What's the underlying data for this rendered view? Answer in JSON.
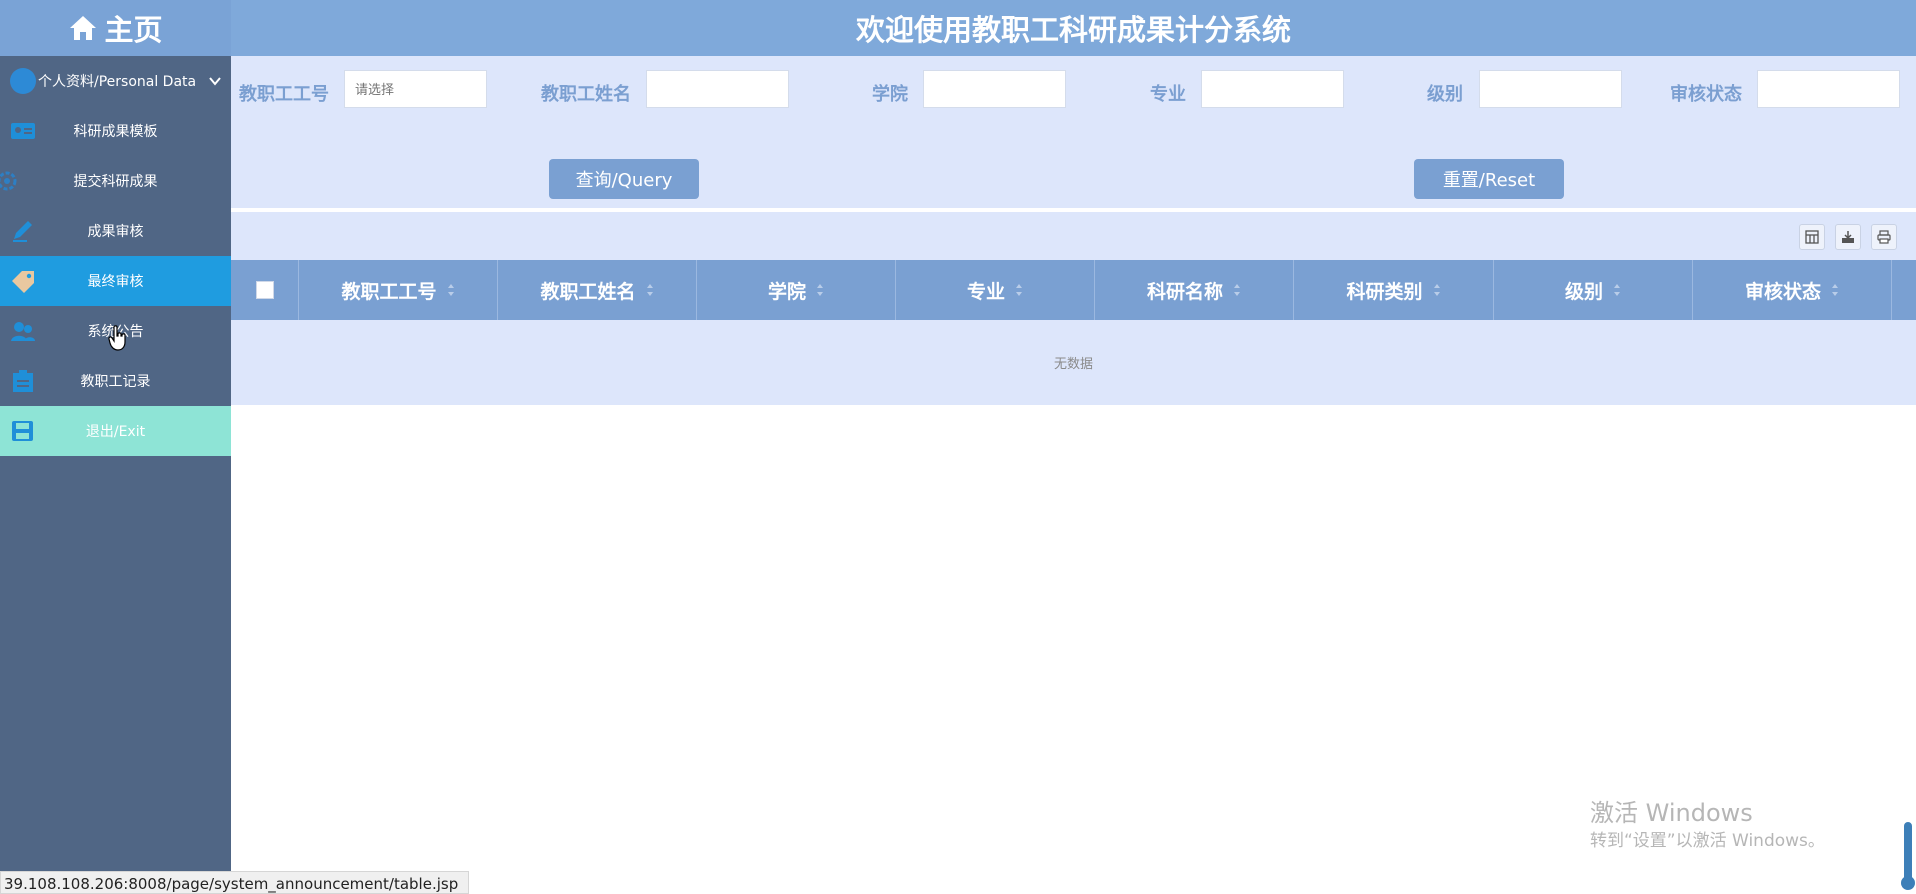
{
  "sidebar": {
    "home_label": "主页",
    "profile_label": "个人资料/Personal Data",
    "items": [
      {
        "label": "科研成果模板",
        "icon": "id-card-icon"
      },
      {
        "label": "提交科研成果",
        "icon": "gear-icon"
      },
      {
        "label": "成果审核",
        "icon": "pencil-icon"
      },
      {
        "label": "最终审核",
        "icon": "tag-icon"
      },
      {
        "label": "系统公告",
        "icon": "users-icon"
      },
      {
        "label": "教职工记录",
        "icon": "document-icon"
      }
    ],
    "exit_label": "退出/Exit",
    "active_index": 3
  },
  "header": {
    "title": "欢迎使用教职工科研成果计分系统"
  },
  "search": {
    "fields": [
      {
        "label": "教职工工号",
        "placeholder": "请选择"
      },
      {
        "label": "教职工姓名",
        "placeholder": ""
      },
      {
        "label": "学院",
        "placeholder": ""
      },
      {
        "label": "专业",
        "placeholder": ""
      },
      {
        "label": "级别",
        "placeholder": ""
      },
      {
        "label": "审核状态",
        "placeholder": ""
      }
    ],
    "query_label": "查询/Query",
    "reset_label": "重置/Reset"
  },
  "toolbar": {
    "icons": [
      "columns-icon",
      "export-icon",
      "print-icon"
    ]
  },
  "table": {
    "columns": [
      "教职工工号",
      "教职工姓名",
      "学院",
      "专业",
      "科研名称",
      "科研类别",
      "级别",
      "审核状态"
    ],
    "empty_text": "无数据"
  },
  "watermark": {
    "line1": "激活 Windows",
    "line2": "转到“设置”以激活 Windows。"
  },
  "status_url": "39.108.108.206:8008/page/system_announcement/table.jsp",
  "colors": {
    "sidebar": "#506685",
    "header": "#7fa9da",
    "active_item": "#1f9ce0",
    "exit_item": "#8ee4d6",
    "panel": "#dde6fb",
    "button": "#7aa0d2"
  }
}
